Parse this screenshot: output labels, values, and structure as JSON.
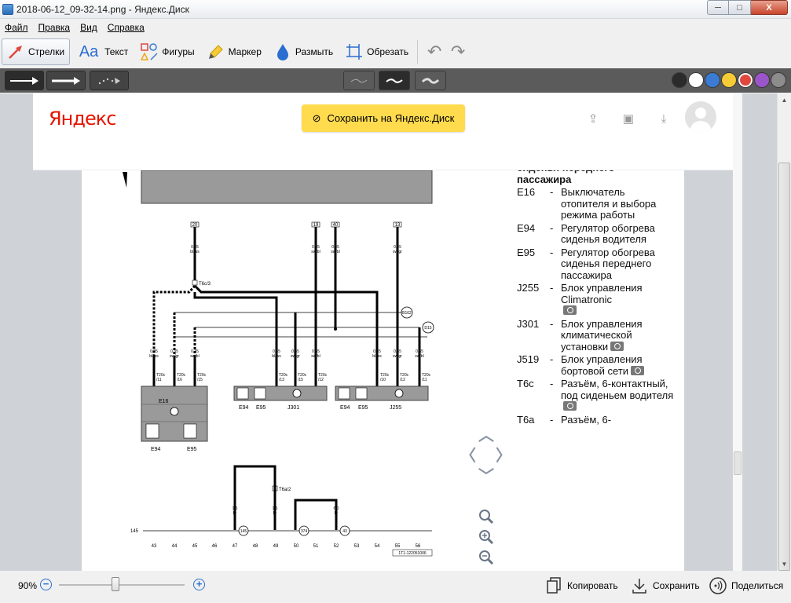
{
  "window": {
    "title": "2018-06-12_09-32-14.png - Яндекс.Диск",
    "min": "─",
    "max": "□",
    "close": "X"
  },
  "menu": [
    "Файл",
    "Правка",
    "Вид",
    "Справка"
  ],
  "tools": [
    {
      "label": "Стрелки",
      "icon": "arrow-icon",
      "active": true
    },
    {
      "label": "Текст",
      "icon": "text-icon",
      "active": false
    },
    {
      "label": "Фигуры",
      "icon": "shapes-icon",
      "active": false
    },
    {
      "label": "Маркер",
      "icon": "marker-icon",
      "active": false
    },
    {
      "label": "Размыть",
      "icon": "blur-icon",
      "active": false
    },
    {
      "label": "Обрезать",
      "icon": "crop-icon",
      "active": false
    }
  ],
  "palette": [
    "#2b2b2b",
    "#ffffff",
    "#3b7bd4",
    "#f6cb35",
    "#e0483d",
    "#9a55c8",
    "#8c8c8c"
  ],
  "selected_color": "#e0483d",
  "yandex": {
    "logo": "Яндекс",
    "save_button": "Сохранить на Яндекс.Диск"
  },
  "schematic": {
    "top_connectors": [
      "20",
      "19",
      "40",
      "13"
    ],
    "wire_labels": {
      "w1": "0,35",
      "w1c": "bl/ws",
      "w2": "0,35",
      "w2c": "sw/bl",
      "w3": "0,35",
      "w3c": "sw/bl",
      "w4": "0,35",
      "w4c": "sw/gr"
    },
    "splice": "T6c/3",
    "circle_labels": [
      "B162",
      "D15"
    ],
    "pin_labels": {
      "p1": "T20c",
      "p1n": "/11",
      "p2": "T20c",
      "p2n": "/16",
      "p3": "T20c",
      "p3n": "/15",
      "p4": "T20c",
      "p4n": "/13",
      "p5": "T20c",
      "p5n": "/15",
      "p6": "T20c",
      "p6n": "/12",
      "p7": "T20c",
      "p7n": "/10",
      "p8": "T20c",
      "p8n": "/12",
      "p9": "T20c",
      "p9n": "/11"
    },
    "lower_wires": {
      "a": "1,5",
      "ac": "br",
      "b": "1,5",
      "bc": "br",
      "c": "6,0",
      "cc": "br"
    },
    "splice2": "T6a/2",
    "components": {
      "e16": "E16",
      "e94a": "E94",
      "e95a": "E95",
      "e94b": "E94",
      "e95b": "E95",
      "j301": "J301",
      "e94c": "E94",
      "e95c": "E95",
      "j255": "J255"
    },
    "ground_label": "145",
    "ground_circles": [
      "145",
      "374",
      "43"
    ],
    "bottom_numbers": [
      "43",
      "44",
      "45",
      "46",
      "47",
      "48",
      "49",
      "50",
      "51",
      "52",
      "53",
      "54",
      "55",
      "56"
    ],
    "ref_code": "1T1-122051006",
    "wire_bottom": {
      "b1": "0,35",
      "b1c": "bl/ws",
      "b2": "0,35",
      "b2c": "sw/gr",
      "b3": "0,35",
      "b3c": "sw/bl",
      "b4": "0,35",
      "b4c": "bl/ws",
      "b5": "0,35",
      "b5c": "sw/gr",
      "b6": "0,35",
      "b6c": "sw/bl",
      "b7": "0,35",
      "b7c": "bl/ws",
      "b8": "0,35",
      "b8c": "sw/gr",
      "b9": "0,35",
      "b9c": "sw/bl"
    }
  },
  "legend": {
    "head1": "сиденья переднего",
    "head2": "пассажира",
    "rows": [
      {
        "code": "E16",
        "dash": "-",
        "desc": "Выключатель отопителя и выбора режима работы",
        "cam": false
      },
      {
        "code": "E94",
        "dash": "-",
        "desc": "Регулятор обогрева сиденья водителя",
        "cam": false
      },
      {
        "code": "E95",
        "dash": "-",
        "desc": "Регулятор обогрева сиденья переднего пассажира",
        "cam": false
      },
      {
        "code": "J255",
        "dash": "-",
        "desc": "Блок управления Climatronic",
        "cam": true
      },
      {
        "code": "J301",
        "dash": "-",
        "desc": "Блок управления климатической установки",
        "cam": true
      },
      {
        "code": "J519",
        "dash": "-",
        "desc": "Блок управления бортовой сети",
        "cam": true
      },
      {
        "code": "T6c",
        "dash": "-",
        "desc": "Разъём, 6-контактный, под сиденьем водителя",
        "cam": true
      },
      {
        "code": "T6a",
        "dash": "-",
        "desc": "Разъём, 6-",
        "cam": false
      }
    ]
  },
  "status": {
    "zoom": "90%",
    "copy": "Копировать",
    "save": "Сохранить",
    "share": "Поделиться"
  }
}
